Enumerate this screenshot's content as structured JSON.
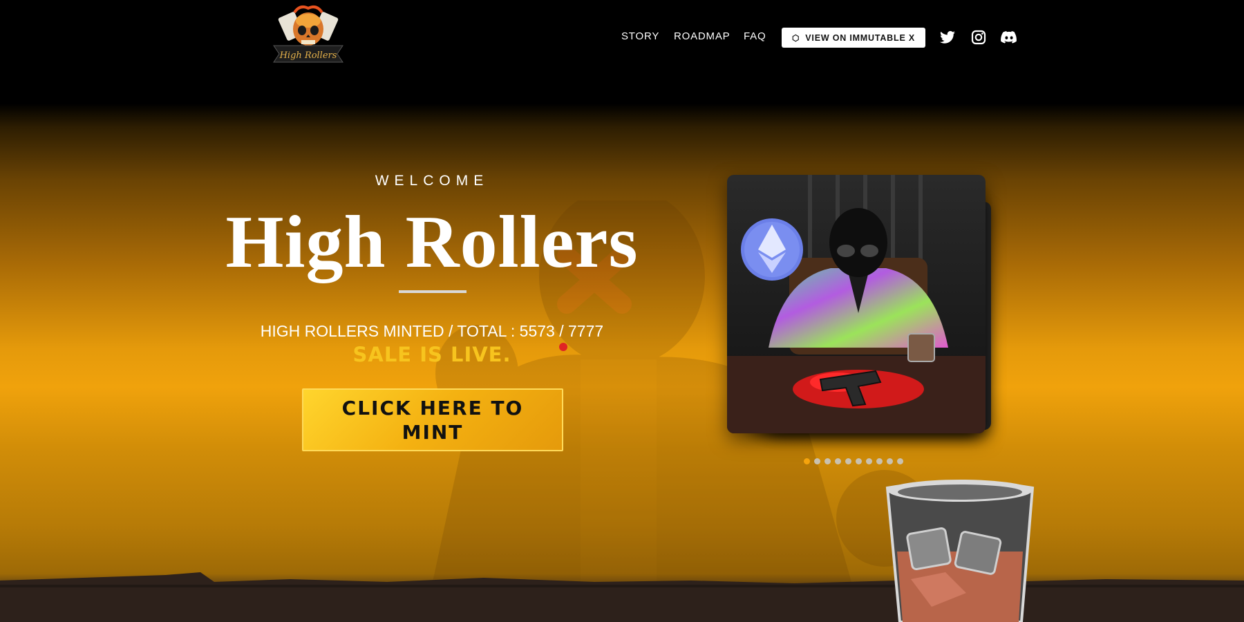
{
  "header": {
    "logo_text": "High Rollers",
    "nav": [
      {
        "label": "STORY"
      },
      {
        "label": "ROADMAP"
      },
      {
        "label": "FAQ"
      }
    ],
    "cta_label": "VIEW ON IMMUTABLE X",
    "social": [
      {
        "icon": "twitter-icon"
      },
      {
        "icon": "instagram-icon"
      },
      {
        "icon": "discord-icon"
      }
    ]
  },
  "hero": {
    "welcome": "WELCOME",
    "title": "High Rollers",
    "minted_text": "HIGH ROLLERS MINTED / TOTAL : 5573 / 7777",
    "sale_status": "SALE IS LIVE.",
    "mint_button": "CLICK HERE TO MINT"
  },
  "carousel": {
    "slide_count": 10,
    "active_index": 0
  },
  "colors": {
    "accent": "#f7c41e",
    "button": "#f4b111",
    "active_dot": "#f5a30d",
    "header_bg": "#000000"
  }
}
